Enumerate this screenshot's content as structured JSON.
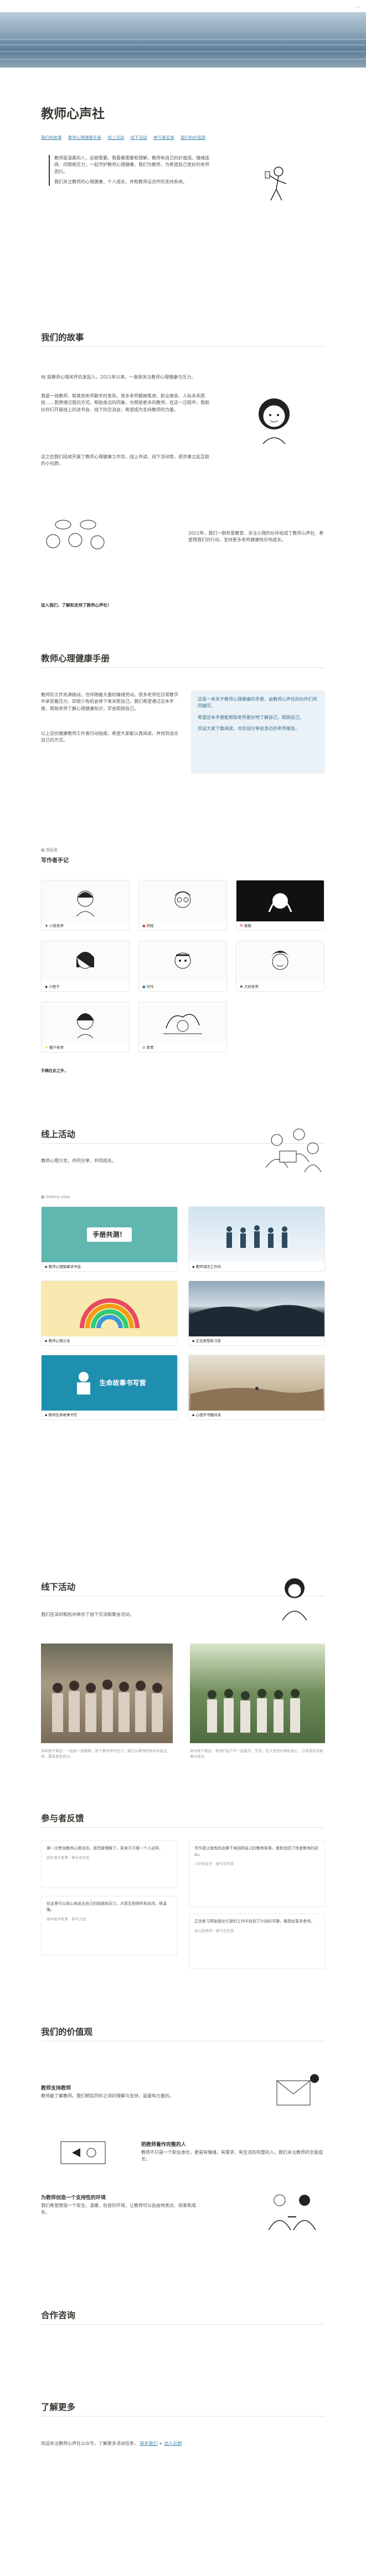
{
  "topbar": {
    "more_icon": "⋯"
  },
  "title": "教师心声社",
  "toc": [
    "我们的故事",
    "教师心理健康手册",
    "线上活动",
    "线下活动",
    "参与者反馈",
    "我们的价值观"
  ],
  "intro": [
    "教师是温柔的人，总被需要。我看着需要和理解，教师有自己的价值观、情绪选择、问题和压力；一起守护教师心理健康，我们为教师、为希望自己变好的老师而行。",
    "我们关注教师的心理健康，个人成长，并和教师话合作的支持系统。"
  ],
  "story": {
    "heading": "我们的故事",
    "p1": "NJ 是教师心理关怀的发起人。2021年以来，一直很关注教师心理健康与压力。",
    "p2": "我是一线教师，和其他老师聊天时发现，很多老师都被焦虑、职业倦怠、人际关系困扰……我想通过我的方式，帮助身边的同事，也帮助更多的教师。在这一过程中，我和伙伴们开展线上的读书会、线下的交流会，希望成为支持教师的力量。",
    "p3": "这之后我们陆续开展了教师心理健康工作坊、线上共读、线下活动等，逐步建立起互助的小社群。",
    "p4": "2022年，我们一群热爱教育、关注心理的伙伴组成了教师心声社，希望用我们的行动，支持更多老师健康快乐地成长。",
    "cta": "加入我们，了解和支持了教师心声社！"
  },
  "handbook": {
    "heading": "教师心理健康手册",
    "p1": "教师的工作充满挑战，也伴随着大量的情绪劳动。很多老师在日常教学中承受着压力，却很少有机会停下来关照自己。我们希望通过这本手册，帮助老师了解心理健康知识，学会照顾自己。",
    "p2": "以上这份健康教师工作者行动指南，希望大家能认真阅读，并找到适合自己的方式。",
    "callout": [
      "这是一本关于教师心理健康的手册，由教师心声社的伙伴们共同编写。",
      "希望这本手册能帮助老师更好地了解自己，照顾自己。",
      "欢迎大家下载阅读，也欢迎分享给身边的老师朋友。"
    ],
    "gallery_label": "图画册",
    "subheading": "写作者手记",
    "cards": [
      {
        "caption": "小熊老师",
        "icon": "★"
      },
      {
        "caption": "阿程",
        "icon": "●"
      },
      {
        "caption": "薇薇",
        "icon": "♥"
      },
      {
        "caption": "小橙子",
        "icon": "◆"
      },
      {
        "caption": "玲玲",
        "icon": "●"
      },
      {
        "caption": "大树老师",
        "icon": "♣"
      },
      {
        "caption": "橘子老师",
        "icon": "☀"
      },
      {
        "caption": "青青",
        "icon": "✿"
      }
    ],
    "footer": "手稿在此之外，"
  },
  "online": {
    "heading": "线上活动",
    "p": "教师心理沙龙，共同分享、共同成长。",
    "gallery_label": "Gallery view",
    "cards": [
      {
        "caption": "教师心理健康读书会",
        "banner": "手册共测！"
      },
      {
        "caption": "教师减压工作坊",
        "banner": ""
      },
      {
        "caption": "教师心理沙龙",
        "banner": ""
      },
      {
        "caption": "正念冥想练习营",
        "banner": ""
      },
      {
        "caption": "教师生命故事书写",
        "banner": "生命故事书写营"
      },
      {
        "caption": "心理学书籍共读",
        "banner": ""
      }
    ]
  },
  "offline": {
    "heading": "线下活动",
    "p": "我们在深圳和杭州举办了线下交流和聚会活动。",
    "photos": [
      {
        "caption": "深圳线下聚会：一起玩一起畅聊，放下教学中的压力，我们从教师的身份中走出来，重新发现自己。"
      },
      {
        "caption": "杭州线下聚会：老师们在户外一起徒步、交流，在大自然中放松身心，分享彼此的故事与成长。"
      }
    ]
  },
  "feedback": {
    "heading": "参与者反馈",
    "items": [
      {
        "text": "第一次参加教师心理活动，感觉被理解了，原来不只我一个人这样。",
        "meta": "初中语文老师 · 参与读书会"
      },
      {
        "text": "写作营让我有机会静下来回顾自己的教育故事，重新找回了热爱教育的初心。",
        "meta": "小学班主任 · 参与写作营"
      },
      {
        "text": "在这里可以放心地说出自己的困惑和压力，大家互相倾听和支持，很温暖。",
        "meta": "高中数学老师 · 参与沙龙"
      },
      {
        "text": "正念练习帮助我在忙碌的工作中找到了片刻的平静，推荐给更多老师。",
        "meta": "幼儿园老师 · 参与正念营"
      }
    ]
  },
  "values": {
    "heading": "我们的价值观",
    "items": [
      {
        "title": "教师支持教师",
        "text": "教师最了解教师。我们相信同伴之间的理解与支持，是最有力量的。"
      },
      {
        "title": "把教师看作完整的人",
        "text": "教师不只是一个职业身份，更是有情绪、有需求、有生活的完整的人。我们关注教师的全面成长。"
      },
      {
        "title": "为教师创造一个支持性的环境",
        "text": "我们希望营造一个安全、温暖、包容的环境，让教师可以自由地表达、探索和成长。"
      }
    ]
  },
  "cooperation": {
    "heading": "合作咨询"
  },
  "learn_more": {
    "heading": "了解更多",
    "text": "欢迎关注教师心声社公众号，了解更多活动信息，",
    "link1": "联系我们",
    "link2": "加入社群"
  }
}
